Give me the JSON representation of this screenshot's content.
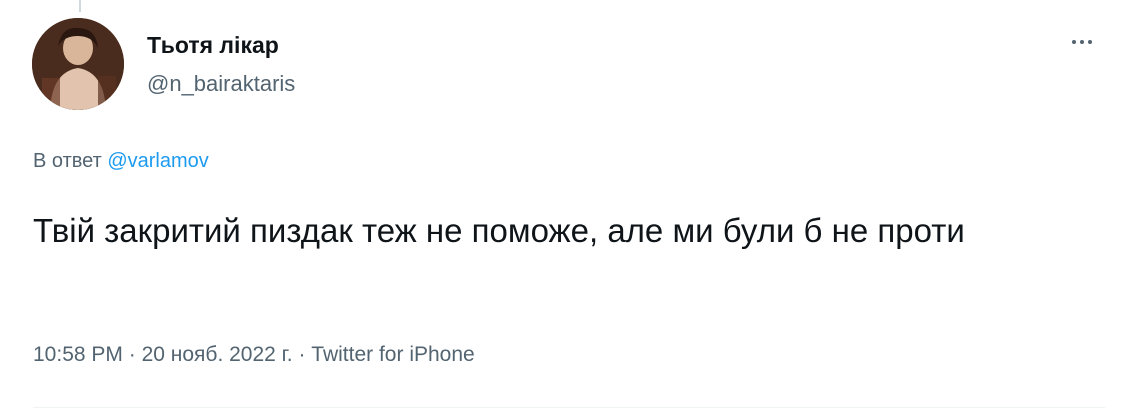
{
  "tweet": {
    "author": {
      "display_name": "Тьотя лікар",
      "handle": "@n_bairaktaris",
      "avatar_icon": "user-avatar"
    },
    "more_icon": "more-horizontal-icon",
    "reply": {
      "prefix": "В ответ",
      "mention": "@varlamov"
    },
    "text": "Твій закритий пиздак теж не поможе, але ми були б не проти",
    "meta": {
      "time": "10:58 PM",
      "separator": "·",
      "date": "20 нояб. 2022 г.",
      "source": "Twitter for iPhone"
    }
  },
  "colors": {
    "text_primary": "#0f1419",
    "text_secondary": "#536471",
    "accent": "#1d9bf0",
    "divider": "#eff3f4"
  }
}
